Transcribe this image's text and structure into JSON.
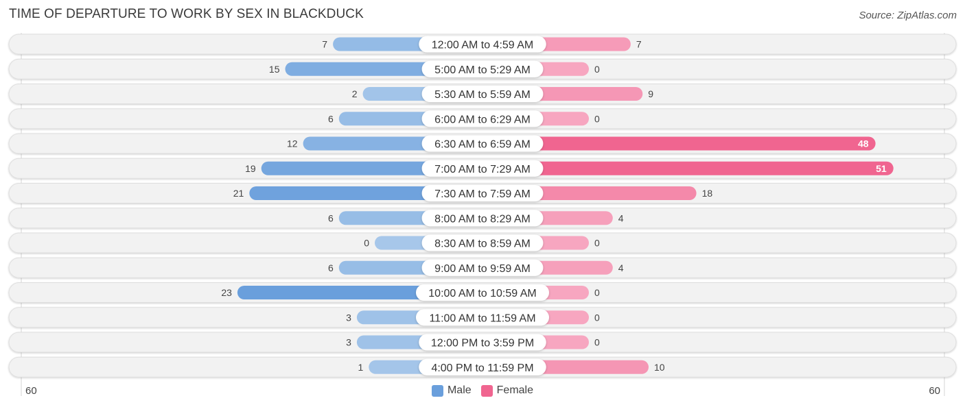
{
  "header": {
    "title": "TIME OF DEPARTURE TO WORK BY SEX IN BLACKDUCK",
    "source": "Source: ZipAtlas.com"
  },
  "colors": {
    "male": "#6a9fdc",
    "male_light": "#a7c7ea",
    "female": "#f06590",
    "female_light": "#f7a6c0",
    "row_bg": "#f2f2f2"
  },
  "chart_data": {
    "type": "bar",
    "orientation": "horizontal-diverging",
    "title": "TIME OF DEPARTURE TO WORK BY SEX IN BLACKDUCK",
    "categories": [
      "12:00 AM to 4:59 AM",
      "5:00 AM to 5:29 AM",
      "5:30 AM to 5:59 AM",
      "6:00 AM to 6:29 AM",
      "6:30 AM to 6:59 AM",
      "7:00 AM to 7:29 AM",
      "7:30 AM to 7:59 AM",
      "8:00 AM to 8:29 AM",
      "8:30 AM to 8:59 AM",
      "9:00 AM to 9:59 AM",
      "10:00 AM to 10:59 AM",
      "11:00 AM to 11:59 AM",
      "12:00 PM to 3:59 PM",
      "4:00 PM to 11:59 PM"
    ],
    "series": [
      {
        "name": "Male",
        "values": [
          7,
          15,
          2,
          6,
          12,
          19,
          21,
          6,
          0,
          6,
          23,
          3,
          3,
          1
        ]
      },
      {
        "name": "Female",
        "values": [
          7,
          0,
          9,
          0,
          48,
          51,
          18,
          4,
          0,
          4,
          0,
          0,
          0,
          10
        ]
      }
    ],
    "axis": {
      "left_label": "60",
      "right_label": "60",
      "range": [
        0,
        60
      ]
    },
    "legend": {
      "position": "bottom-center",
      "entries": [
        "Male",
        "Female"
      ]
    },
    "grid": false
  }
}
